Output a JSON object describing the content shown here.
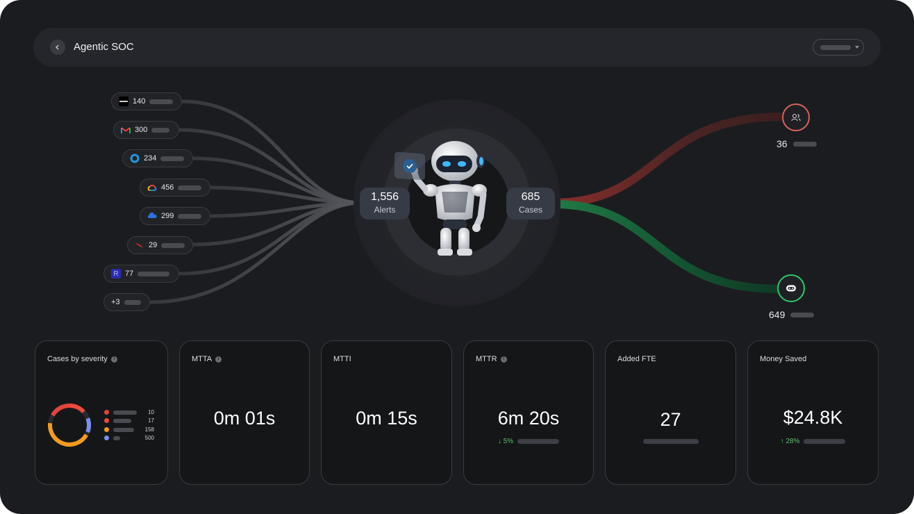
{
  "header": {
    "title": "Agentic SOC"
  },
  "sources": [
    {
      "icon": "splunk-icon",
      "value": "140"
    },
    {
      "icon": "gmail-icon",
      "value": "300"
    },
    {
      "icon": "crowdstrike-ring-icon",
      "value": "234"
    },
    {
      "icon": "google-cloud-icon",
      "value": "456"
    },
    {
      "icon": "azure-cloud-icon",
      "value": "299"
    },
    {
      "icon": "falcon-icon",
      "value": "29"
    },
    {
      "icon": "rapid7-icon",
      "value": "77"
    },
    {
      "icon": "",
      "value": "+3"
    }
  ],
  "hub": {
    "alerts_value": "1,556",
    "alerts_label": "Alerts",
    "cases_value": "685",
    "cases_label": "Cases"
  },
  "outputs": {
    "human": {
      "value": "36",
      "icon": "users-icon",
      "color": "#e0695c"
    },
    "ai": {
      "value": "649",
      "icon": "bot-icon",
      "color": "#27c36a"
    }
  },
  "cards": {
    "severity": {
      "title": "Cases by severity",
      "legend": [
        {
          "value": "10",
          "color": "#e2453c"
        },
        {
          "value": "17",
          "color": "#ec4b3f"
        },
        {
          "value": "158",
          "color": "#f29b1d"
        },
        {
          "value": "500",
          "color": "#7b8ff0"
        }
      ]
    },
    "mtta": {
      "title": "MTTA",
      "value": "0m 01s"
    },
    "mtti": {
      "title": "MTTI",
      "value": "0m 15s"
    },
    "mttr": {
      "title": "MTTR",
      "value": "6m 20s",
      "trend": "↓ 5%",
      "trend_color": "#5cc069"
    },
    "fte": {
      "title": "Added FTE",
      "value": "27"
    },
    "money": {
      "title": "Money Saved",
      "value": "$24.8K",
      "trend": "↑ 28%",
      "trend_color": "#5cc069"
    }
  }
}
